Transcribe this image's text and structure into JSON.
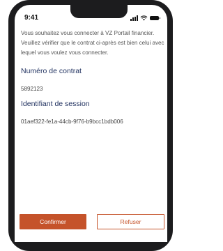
{
  "status_bar": {
    "time": "9:41"
  },
  "dialog": {
    "message": "Vous souhaitez vous connecter à VZ Portail financier. Veuillez vérifier que le contrat ci-après est bien celui avec lequel vous voulez vous connecter.",
    "contract_label": "Numéro de contrat",
    "contract_value": "5892123",
    "session_label": "Identifiant de session",
    "session_value": "01aef322-fe1a-44cb-9f76-b9bcc1bdb006"
  },
  "actions": {
    "confirm_label": "Confirmer",
    "refuse_label": "Refuser"
  },
  "colors": {
    "accent": "#c5532a",
    "label": "#1e2f5e",
    "text": "#555555",
    "phone_frame": "#1c1c1e"
  }
}
